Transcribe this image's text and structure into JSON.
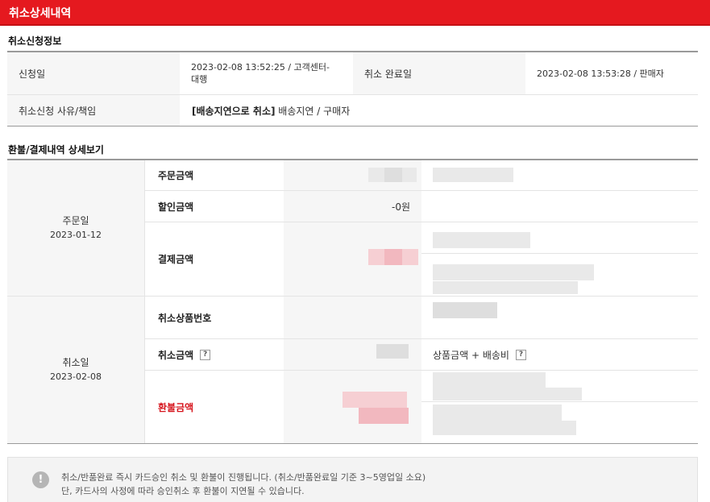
{
  "header": {
    "title": "취소상세내역"
  },
  "cancel_info": {
    "section_title": "취소신청정보",
    "request_date_label": "신청일",
    "request_date_value_line1": "2023-02-08 13:52:25 / 고객센터-",
    "request_date_value_line2": "대행",
    "complete_date_label": "취소 완료일",
    "complete_date_value": "2023-02-08 13:53:28 / 판매자",
    "reason_label": "취소신청 사유/책임",
    "reason_highlight": "[배송지연으로 취소]",
    "reason_rest": " 배송지연 / 구매자"
  },
  "refund_detail": {
    "section_title": "환불/결제내역 상세보기",
    "order_group": {
      "label": "주문일",
      "date": "2023-01-12",
      "rows": {
        "order_amount_label": "주문금액",
        "discount_label": "할인금액",
        "discount_value": "-0원",
        "payment_label": "결제금액"
      }
    },
    "cancel_group": {
      "label": "취소일",
      "date": "2023-02-08",
      "rows": {
        "cancel_item_no_label": "취소상품번호",
        "cancel_amount_label": "취소금액",
        "cancel_amount_note": "상품금액 + 배송비",
        "refund_amount_label": "환불금액"
      }
    },
    "help_icon_glyph": "?"
  },
  "notice": {
    "icon_glyph": "!",
    "line1": "취소/반품완료 즉시 카드승인 취소 및 환불이 진행됩니다. (취소/반품완료일 기준 3~5영업일 소요)",
    "line2": "단, 카드사의 사정에 따라 승인취소 후 환불이 지연될 수 있습니다."
  },
  "colors": {
    "accent": "#e5191f",
    "refund_label": "#d6141c"
  }
}
